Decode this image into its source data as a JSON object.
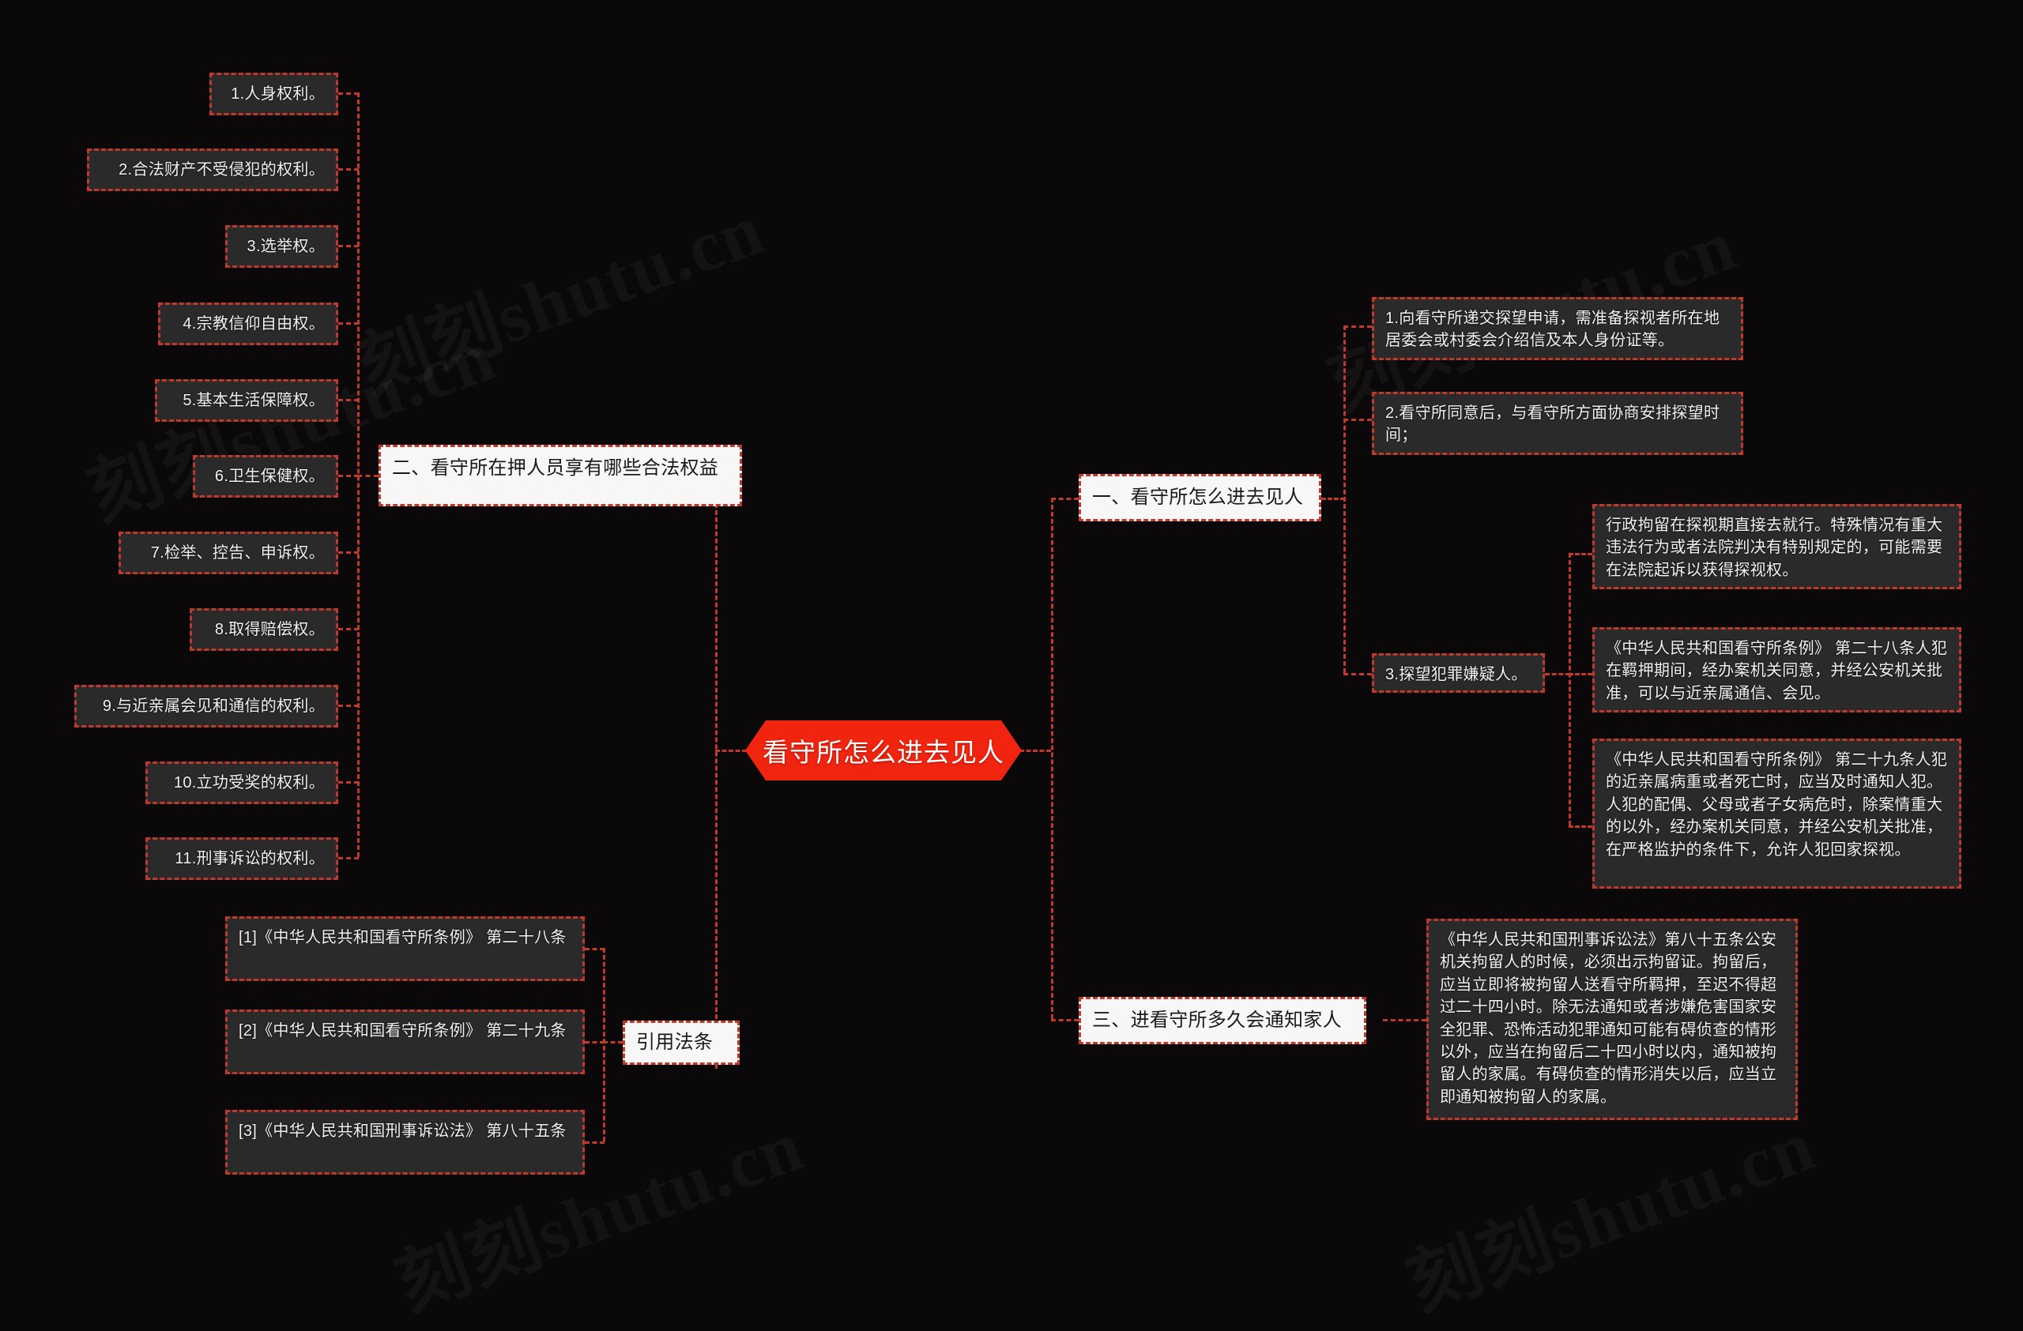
{
  "meta": {
    "title": "看守所怎么进去见人",
    "accent_red": "#c0392b",
    "root_red": "#f0240f",
    "node_bg": "#2b2a2a",
    "white_node_bg": "#f7f7f7",
    "background": "#0b0809"
  },
  "watermarks": [
    "刻刻shutu.cn",
    "刻刻shutu.cn",
    "刻刻shutu.cn",
    "刻刻shutu.cn",
    "刻刻shutu.cn"
  ],
  "root": {
    "label": "看守所怎么进去见人"
  },
  "branches": {
    "rights": {
      "label": "二、看守所在押人员享有哪些合法权益",
      "items": [
        "1.人身权利。",
        "2.合法财产不受侵犯的权利。",
        "3.选举权。",
        "4.宗教信仰自由权。",
        "5.基本生活保障权。",
        "6.卫生保健权。",
        "7.检举、控告、申诉权。",
        "8.取得赔偿权。",
        "9.与近亲属会见和通信的权利。",
        "10.立功受奖的权利。",
        "11.刑事诉讼的权利。"
      ]
    },
    "citations": {
      "label": "引用法条",
      "items": [
        "[1]《中华人民共和国看守所条例》 第二十八条",
        "[2]《中华人民共和国看守所条例》 第二十九条",
        "[3]《中华人民共和国刑事诉讼法》 第八十五条"
      ]
    },
    "visit": {
      "label": "一、看守所怎么进去见人",
      "items": [
        "1.向看守所递交探望申请，需准备探视者所在地居委会或村委会介绍信及本人身份证等。",
        "2.看守所同意后，与看守所方面协商安排探望时间；",
        "3.探望犯罪嫌疑人。"
      ],
      "sub_items": [
        "行政拘留在探视期直接去就行。特殊情况有重大违法行为或者法院判决有特别规定的，可能需要在法院起诉以获得探视权。",
        "《中华人民共和国看守所条例》 第二十八条人犯在羁押期间，经办案机关同意，并经公安机关批准，可以与近亲属通信、会见。",
        "《中华人民共和国看守所条例》 第二十九条人犯的近亲属病重或者死亡时，应当及时通知人犯。人犯的配偶、父母或者子女病危时，除案情重大的以外，经办案机关同意，并经公安机关批准，在严格监护的条件下，允许人犯回家探视。"
      ]
    },
    "notify": {
      "label": "三、进看守所多久会通知家人",
      "items": [
        "《中华人民共和国刑事诉讼法》第八十五条公安机关拘留人的时候，必须出示拘留证。拘留后，应当立即将被拘留人送看守所羁押，至迟不得超过二十四小时。除无法通知或者涉嫌危害国家安全犯罪、恐怖活动犯罪通知可能有碍侦查的情形以外，应当在拘留后二十四小时以内，通知被拘留人的家属。有碍侦查的情形消失以后，应当立即通知被拘留人的家属。"
      ]
    }
  }
}
